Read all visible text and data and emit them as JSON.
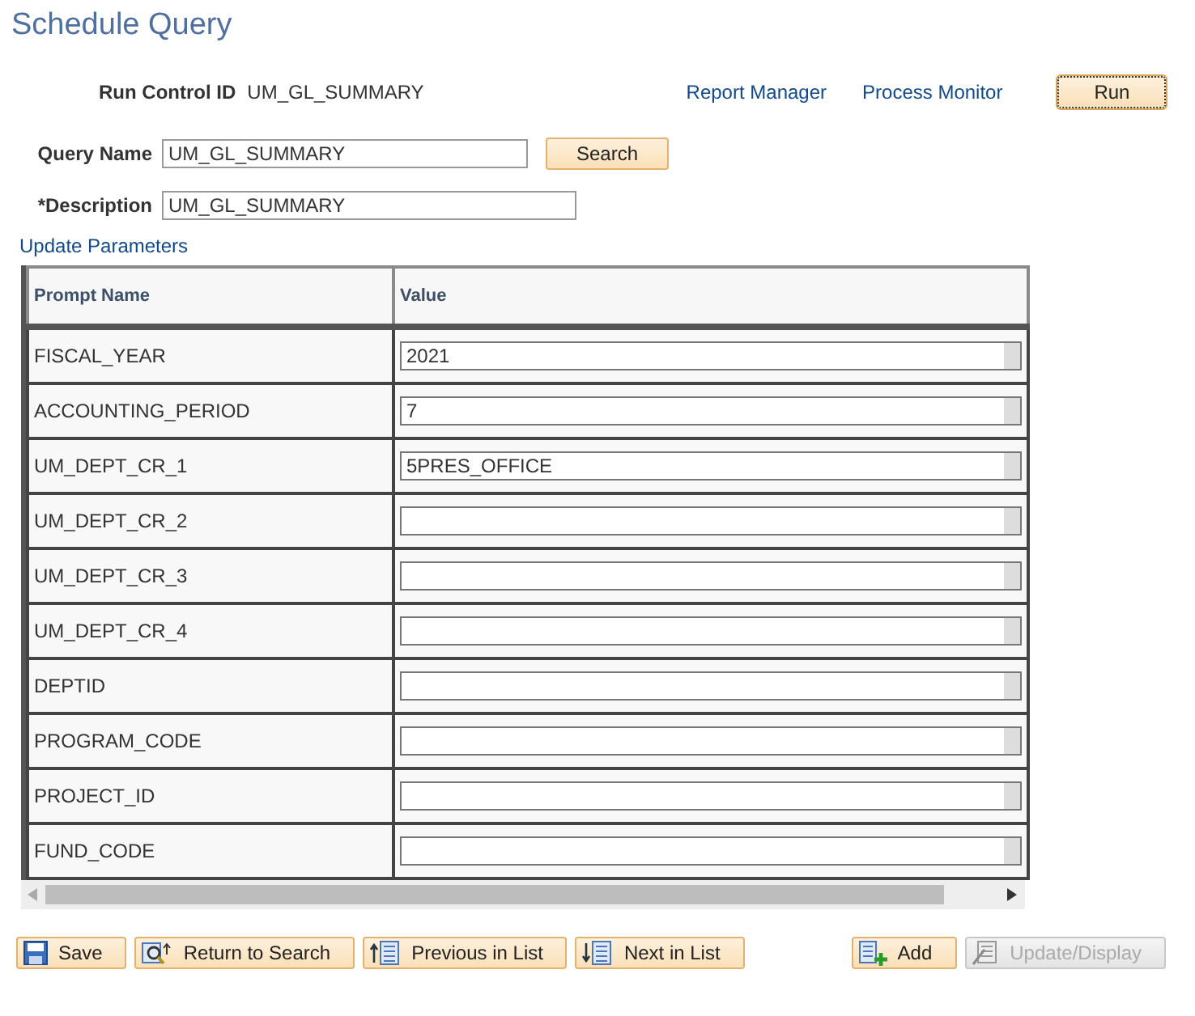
{
  "title": "Schedule Query",
  "run_control": {
    "label": "Run Control ID",
    "value": "UM_GL_SUMMARY"
  },
  "links": [
    "Report Manager",
    "Process Monitor"
  ],
  "run_button": "Run",
  "query_name": {
    "label": "Query Name",
    "value": "UM_GL_SUMMARY",
    "button": "Search"
  },
  "description": {
    "label": "*Description",
    "value": "UM_GL_SUMMARY"
  },
  "section_link": "Update Parameters",
  "table": {
    "columns": [
      "Prompt Name",
      "Value"
    ],
    "rows": [
      {
        "prompt": "FISCAL_YEAR",
        "value": "2021"
      },
      {
        "prompt": "ACCOUNTING_PERIOD",
        "value": "7"
      },
      {
        "prompt": "UM_DEPT_CR_1",
        "value": "5PRES_OFFICE"
      },
      {
        "prompt": "UM_DEPT_CR_2"
      },
      {
        "prompt": "UM_DEPT_CR_3"
      },
      {
        "prompt": "UM_DEPT_CR_4"
      },
      {
        "prompt": "DEPTID"
      },
      {
        "prompt": "PROGRAM_CODE"
      },
      {
        "prompt": "PROJECT_ID"
      },
      {
        "prompt": "FUND_CODE"
      }
    ]
  },
  "buttons_left": [
    {
      "kind": "save",
      "label": "Save",
      "disabled": false
    },
    {
      "kind": "return",
      "label": "Return to Search",
      "disabled": false
    },
    {
      "kind": "previous",
      "label": "Previous in List",
      "disabled": false
    },
    {
      "kind": "next",
      "label": "Next in List",
      "disabled": false
    }
  ],
  "buttons_right": [
    {
      "kind": "add",
      "label": "Add",
      "disabled": false
    },
    {
      "kind": "update",
      "label": "Update/Display",
      "disabled": true
    }
  ]
}
